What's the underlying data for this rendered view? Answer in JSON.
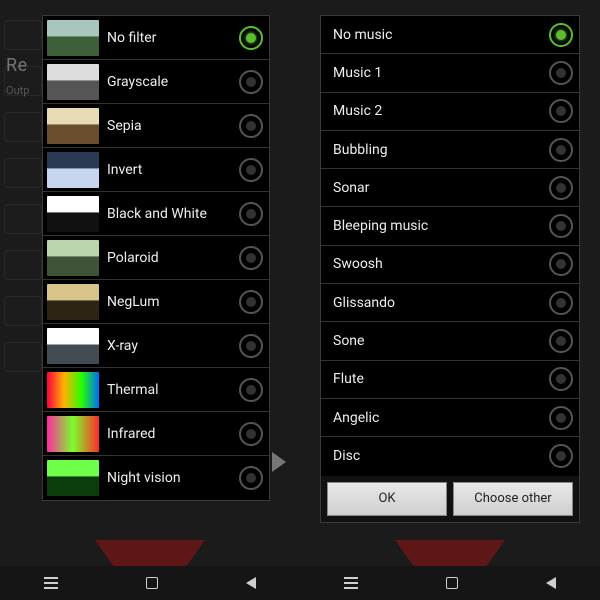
{
  "bg": {
    "title_left": "Re",
    "subtitle_left": "Outp"
  },
  "filters": {
    "items": [
      {
        "label": "No filter",
        "thumb": "th-nofilter",
        "selected": true
      },
      {
        "label": "Grayscale",
        "thumb": "th-gray",
        "selected": false
      },
      {
        "label": "Sepia",
        "thumb": "th-sepia",
        "selected": false
      },
      {
        "label": "Invert",
        "thumb": "th-invert",
        "selected": false
      },
      {
        "label": "Black and White",
        "thumb": "th-bw",
        "selected": false
      },
      {
        "label": "Polaroid",
        "thumb": "th-polaroid",
        "selected": false
      },
      {
        "label": "NegLum",
        "thumb": "th-neglum",
        "selected": false
      },
      {
        "label": "X-ray",
        "thumb": "th-xray",
        "selected": false
      },
      {
        "label": "Thermal",
        "thumb": "th-thermal",
        "selected": false
      },
      {
        "label": "Infrared",
        "thumb": "th-infrared",
        "selected": false
      },
      {
        "label": "Night vision",
        "thumb": "th-night",
        "selected": false
      }
    ]
  },
  "music": {
    "items": [
      {
        "label": "No music",
        "selected": true
      },
      {
        "label": "Music 1",
        "selected": false
      },
      {
        "label": "Music 2",
        "selected": false
      },
      {
        "label": "Bubbling",
        "selected": false
      },
      {
        "label": "Sonar",
        "selected": false
      },
      {
        "label": "Bleeping music",
        "selected": false
      },
      {
        "label": "Swoosh",
        "selected": false
      },
      {
        "label": "Glissando",
        "selected": false
      },
      {
        "label": "Sone",
        "selected": false
      },
      {
        "label": "Flute",
        "selected": false
      },
      {
        "label": "Angelic",
        "selected": false
      },
      {
        "label": "Disc",
        "selected": false
      }
    ],
    "buttons": {
      "ok": "OK",
      "choose_other": "Choose other"
    }
  }
}
